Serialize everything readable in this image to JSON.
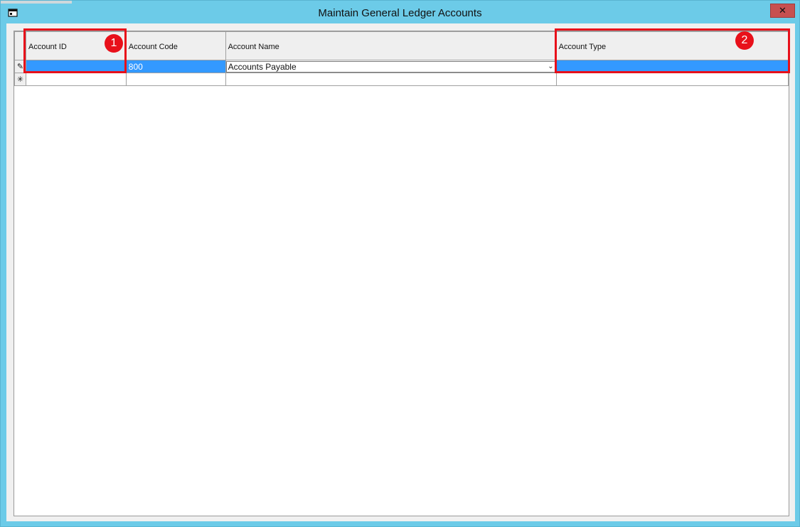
{
  "window": {
    "title": "Maintain General Ledger Accounts",
    "close_label": "x"
  },
  "grid": {
    "columns": [
      "Account ID",
      "Account Code",
      "Account Name",
      "Account Type"
    ],
    "rows": [
      {
        "row_marker": "✎",
        "account_id": "",
        "account_code": "800",
        "account_name": "Accounts Payable",
        "account_type": ""
      }
    ],
    "new_row_marker": "✳"
  },
  "annotations": [
    {
      "label": "1",
      "target": "Account ID"
    },
    {
      "label": "2",
      "target": "Account Type"
    }
  ],
  "colors": {
    "selection": "#3399ff",
    "annotation": "#e8101a",
    "frame": "#6ccbe8"
  }
}
